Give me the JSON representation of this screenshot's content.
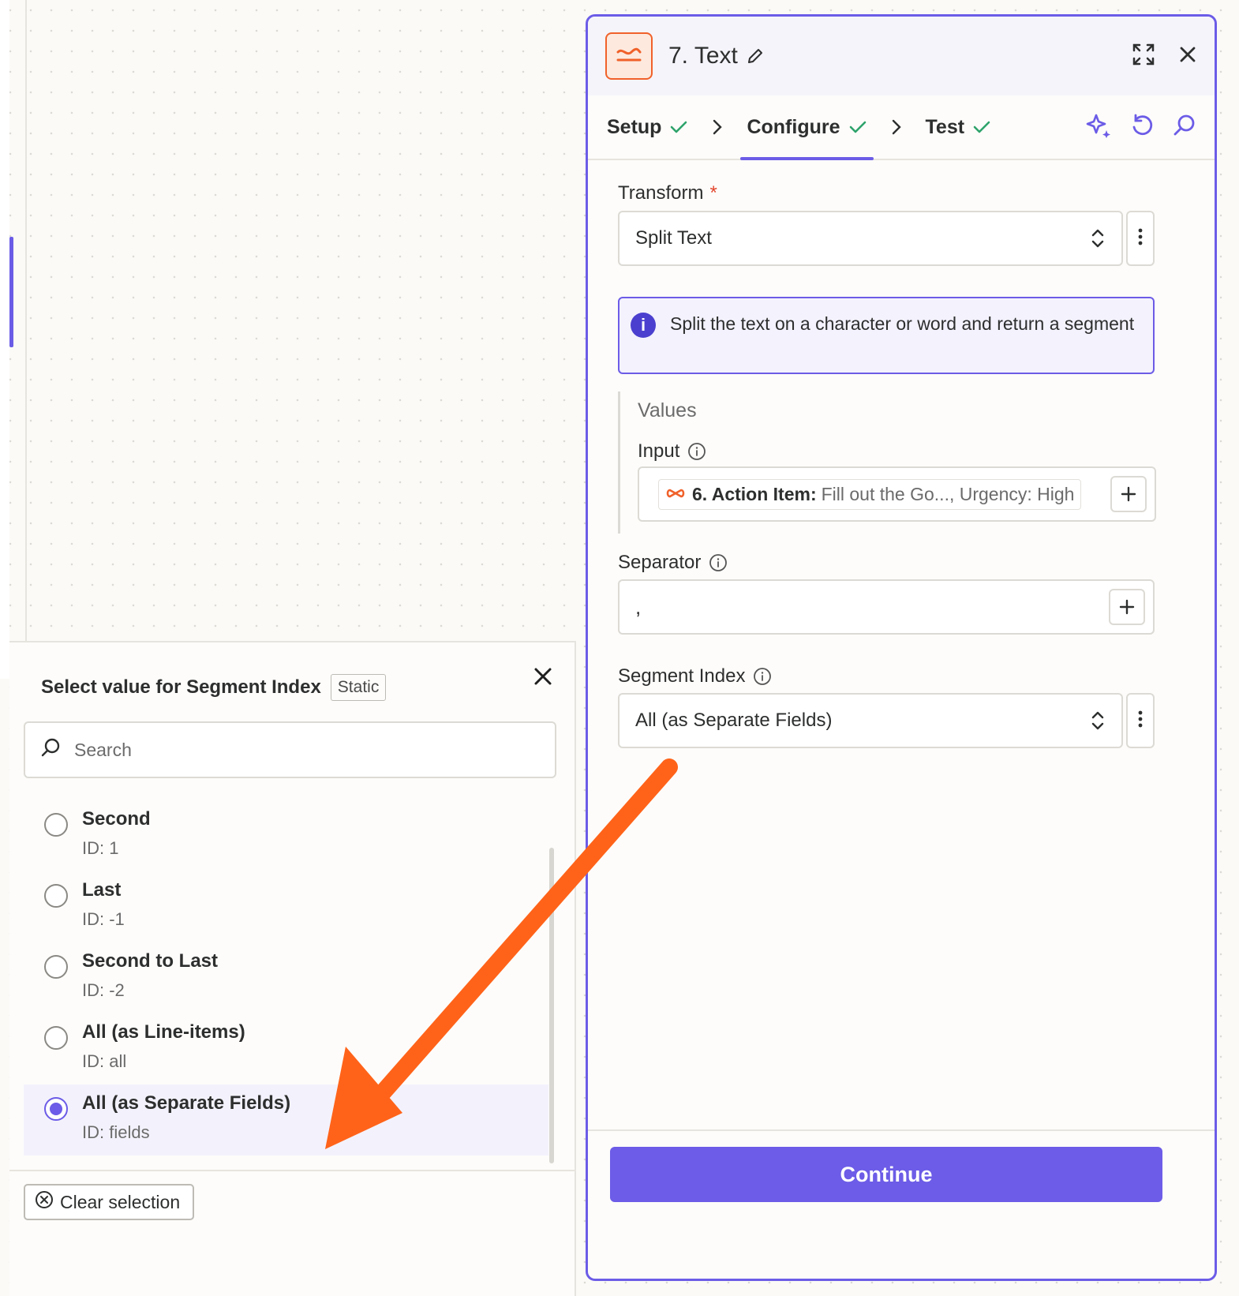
{
  "step": {
    "title": "7. Text",
    "tabs": [
      {
        "label": "Setup"
      },
      {
        "label": "Configure"
      },
      {
        "label": "Test"
      }
    ],
    "active_tab": "Configure",
    "transform": {
      "label": "Transform",
      "required_mark": "*",
      "value": "Split Text"
    },
    "info_message": "Split the text on a character or word and return a segment",
    "values": {
      "title": "Values",
      "input": {
        "label": "Input",
        "pill_label": "6. Action Item:",
        "pill_value": "Fill out the Go..., Urgency: High"
      }
    },
    "separator": {
      "label": "Separator",
      "value": ","
    },
    "segment_index": {
      "label": "Segment Index",
      "value": "All (as Separate Fields)"
    },
    "continue_label": "Continue"
  },
  "popover": {
    "title": "Select value for Segment Index",
    "badge": "Static",
    "search_placeholder": "Search",
    "options": [
      {
        "label": "Second",
        "id": "ID: 1"
      },
      {
        "label": "Last",
        "id": "ID: -1"
      },
      {
        "label": "Second to Last",
        "id": "ID: -2"
      },
      {
        "label": "All (as Line-items)",
        "id": "ID: all"
      },
      {
        "label": "All (as Separate Fields)",
        "id": "ID: fields"
      }
    ],
    "selected_index": 4,
    "clear_label": "Clear selection"
  },
  "colors": {
    "accent": "#6c5ce7",
    "app_orange": "#f0612a",
    "success_green": "#2ea36b",
    "annotation_arrow": "#ff6319"
  }
}
